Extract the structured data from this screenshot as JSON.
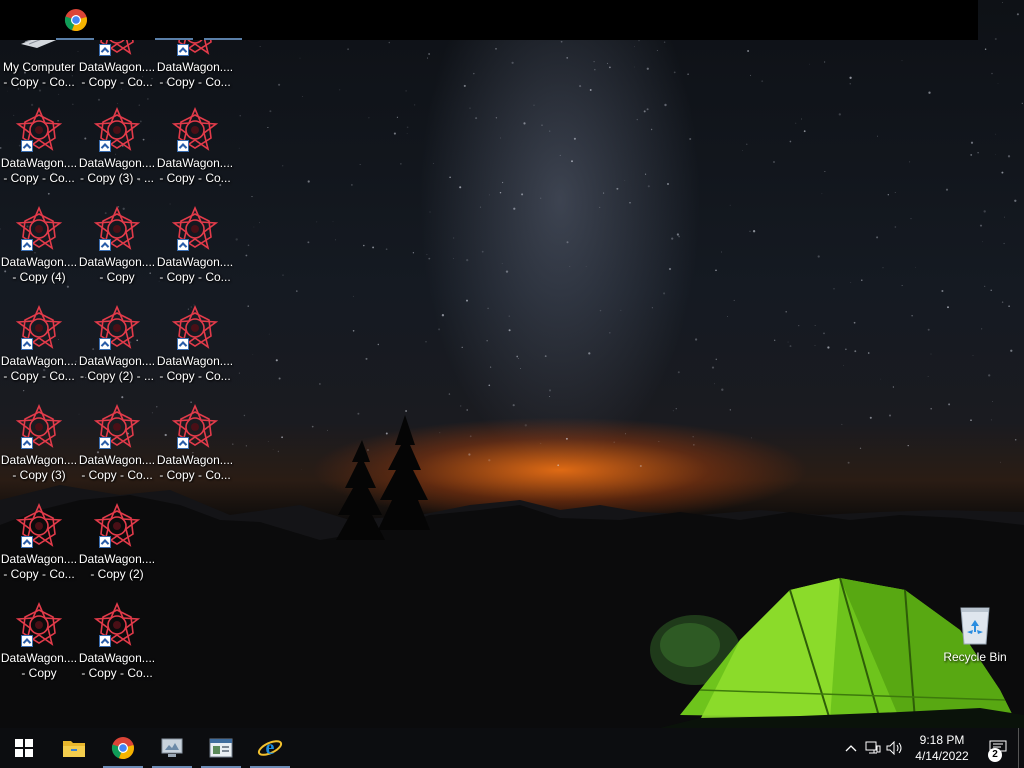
{
  "desktop": {
    "icons": [
      {
        "label1": "My Computer",
        "label2": "- Copy - Co...",
        "kind": "computer"
      },
      {
        "label1": "DataWagon....",
        "label2": "- Copy - Co...",
        "kind": "datawagon"
      },
      {
        "label1": "DataWagon....",
        "label2": "- Copy (4)",
        "kind": "datawagon"
      },
      {
        "label1": "DataWagon....",
        "label2": "- Copy - Co...",
        "kind": "datawagon"
      },
      {
        "label1": "DataWagon....",
        "label2": "- Copy (3)",
        "kind": "datawagon"
      },
      {
        "label1": "DataWagon....",
        "label2": "- Copy - Co...",
        "kind": "datawagon"
      },
      {
        "label1": "DataWagon....",
        "label2": "- Copy",
        "kind": "datawagon"
      },
      {
        "label1": "DataWagon....",
        "label2": "- Copy - Co...",
        "kind": "datawagon"
      },
      {
        "label1": "DataWagon....",
        "label2": "- Copy (3) - ...",
        "kind": "datawagon"
      },
      {
        "label1": "DataWagon....",
        "label2": "- Copy",
        "kind": "datawagon"
      },
      {
        "label1": "DataWagon....",
        "label2": "- Copy (2) - ...",
        "kind": "datawagon"
      },
      {
        "label1": "DataWagon....",
        "label2": "- Copy - Co...",
        "kind": "datawagon"
      },
      {
        "label1": "DataWagon....",
        "label2": "- Copy (2)",
        "kind": "datawagon"
      },
      {
        "label1": "DataWagon....",
        "label2": "- Copy - Co...",
        "kind": "datawagon"
      },
      {
        "label1": "DataWagon....",
        "label2": "- Copy - Co...",
        "kind": "datawagon"
      },
      {
        "label1": "DataWagon....",
        "label2": "- Copy - Co...",
        "kind": "datawagon"
      },
      {
        "label1": "DataWagon....",
        "label2": "- Copy - Co...",
        "kind": "datawagon"
      },
      {
        "label1": "DataWagon....",
        "label2": "- Copy - Co...",
        "kind": "datawagon"
      },
      {
        "label1": "DataWagon....",
        "label2": "- Copy - Co...",
        "kind": "datawagon"
      }
    ],
    "recycle_bin": {
      "label": "Recycle Bin",
      "icon": "recycle-bin-icon"
    }
  },
  "top_bar": {
    "icon": "chrome-icon"
  },
  "taskbar": {
    "buttons": [
      {
        "name": "start",
        "icon": "windows-logo-icon"
      },
      {
        "name": "file-explorer",
        "icon": "folder-icon"
      },
      {
        "name": "chrome",
        "icon": "chrome-icon",
        "active": true
      },
      {
        "name": "remote-app",
        "icon": "monitor-icon",
        "active": true
      },
      {
        "name": "app-window",
        "icon": "window-icon",
        "active": true
      },
      {
        "name": "internet-explorer",
        "icon": "ie-icon",
        "active": true
      }
    ],
    "tray": {
      "time": "9:18 PM",
      "date": "4/14/2022",
      "notification_count": "2"
    }
  },
  "colors": {
    "taskbar": "#0c0d10",
    "accent": "#6d8cb6",
    "datawagon_icon": "#e23b4a"
  }
}
